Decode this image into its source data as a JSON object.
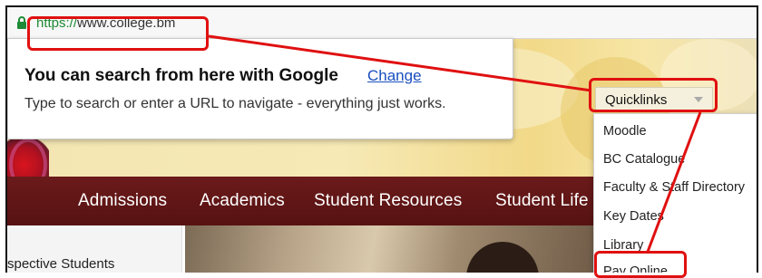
{
  "browser": {
    "url_protocol": "https://",
    "url_host": "www.college.bm"
  },
  "omnibox_hint": {
    "title": "You can search from here with Google",
    "change_link": "Change",
    "body": "Type to search or enter a URL to navigate - everything just works."
  },
  "site": {
    "nav": [
      "Admissions",
      "Academics",
      "Student Resources",
      "Student Life"
    ],
    "left_panel_text": "spective Students"
  },
  "quicklinks": {
    "label": "Quicklinks",
    "items": [
      "Moodle",
      "BC Catalogue",
      "Faculty & Staff Directory",
      "Key Dates",
      "Library",
      "Pay Online"
    ]
  },
  "colors": {
    "annotation_red": "#e01010",
    "nav_bg": "#5f1515",
    "link_blue": "#1a4fbf",
    "secure_green": "#1e8a35"
  }
}
